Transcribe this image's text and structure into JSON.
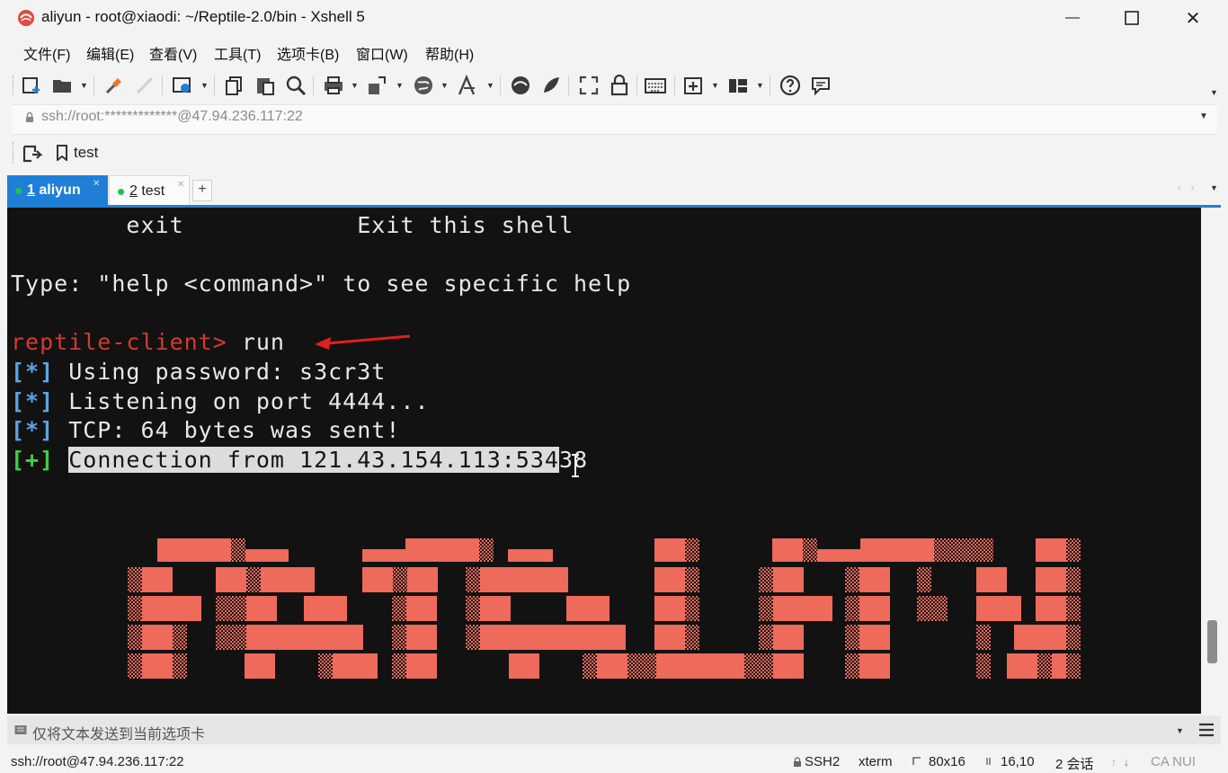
{
  "window": {
    "title": "aliyun - root@xiaodi: ~/Reptile-2.0/bin - Xshell 5",
    "minimize_label": "—",
    "maximize_label": "☐",
    "close_label": "✕"
  },
  "menu": {
    "items": [
      {
        "label": "文件(F)"
      },
      {
        "label": "编辑(E)"
      },
      {
        "label": "查看(V)"
      },
      {
        "label": "工具(T)"
      },
      {
        "label": "选项卡(B)"
      },
      {
        "label": "窗口(W)"
      },
      {
        "label": "帮助(H)"
      }
    ]
  },
  "toolbar": {
    "icons": [
      "new-session-icon",
      "open-folder-icon",
      "connect-icon",
      "disconnect-icon",
      "properties-icon",
      "copy-icon",
      "paste-icon",
      "find-icon",
      "print-icon",
      "transfer-icon",
      "globe-icon",
      "font-icon",
      "xftp-icon",
      "xmanager-icon",
      "fullscreen-icon",
      "lock-icon",
      "keyboard-icon",
      "new-tab-icon",
      "layout-icon",
      "help-icon",
      "chat-icon"
    ]
  },
  "address": {
    "value": "ssh://root:*************@47.94.236.117:22"
  },
  "quickbar": {
    "label": "test"
  },
  "tabs": [
    {
      "number": "1",
      "label": "aliyun",
      "active": true
    },
    {
      "number": "2",
      "label": "test",
      "active": false
    }
  ],
  "tab_add_label": "+",
  "terminal": {
    "lines": {
      "exit_cmd": "        exit",
      "exit_desc": "Exit this shell",
      "help_hint": "Type: \"help <command>\" to see specific help",
      "prompt": "reptile-client>",
      "command": " run",
      "star": "[*]",
      "plus": "[+]",
      "pw": " Using password: s3cr3t",
      "listen": " Listening on port 4444...",
      "tcp": " TCP: 64 bytes was sent!",
      "conn_sel": "Connection from 121.43.154.113:534",
      "conn_rest": "38"
    },
    "banner_color": "#ee6a5b",
    "background": "#121212",
    "prompt_color": "#d43a2f",
    "arrow_color": "#e0201c"
  },
  "compose": {
    "placeholder": "仅将文本发送到当前选项卡"
  },
  "status": {
    "host": "ssh://root@47.94.236.117:22",
    "protocol": "SSH2",
    "term": "xterm",
    "size": "80x16",
    "cursor": "16,10",
    "sessions": "2 会话",
    "caps": "CA NUI"
  }
}
